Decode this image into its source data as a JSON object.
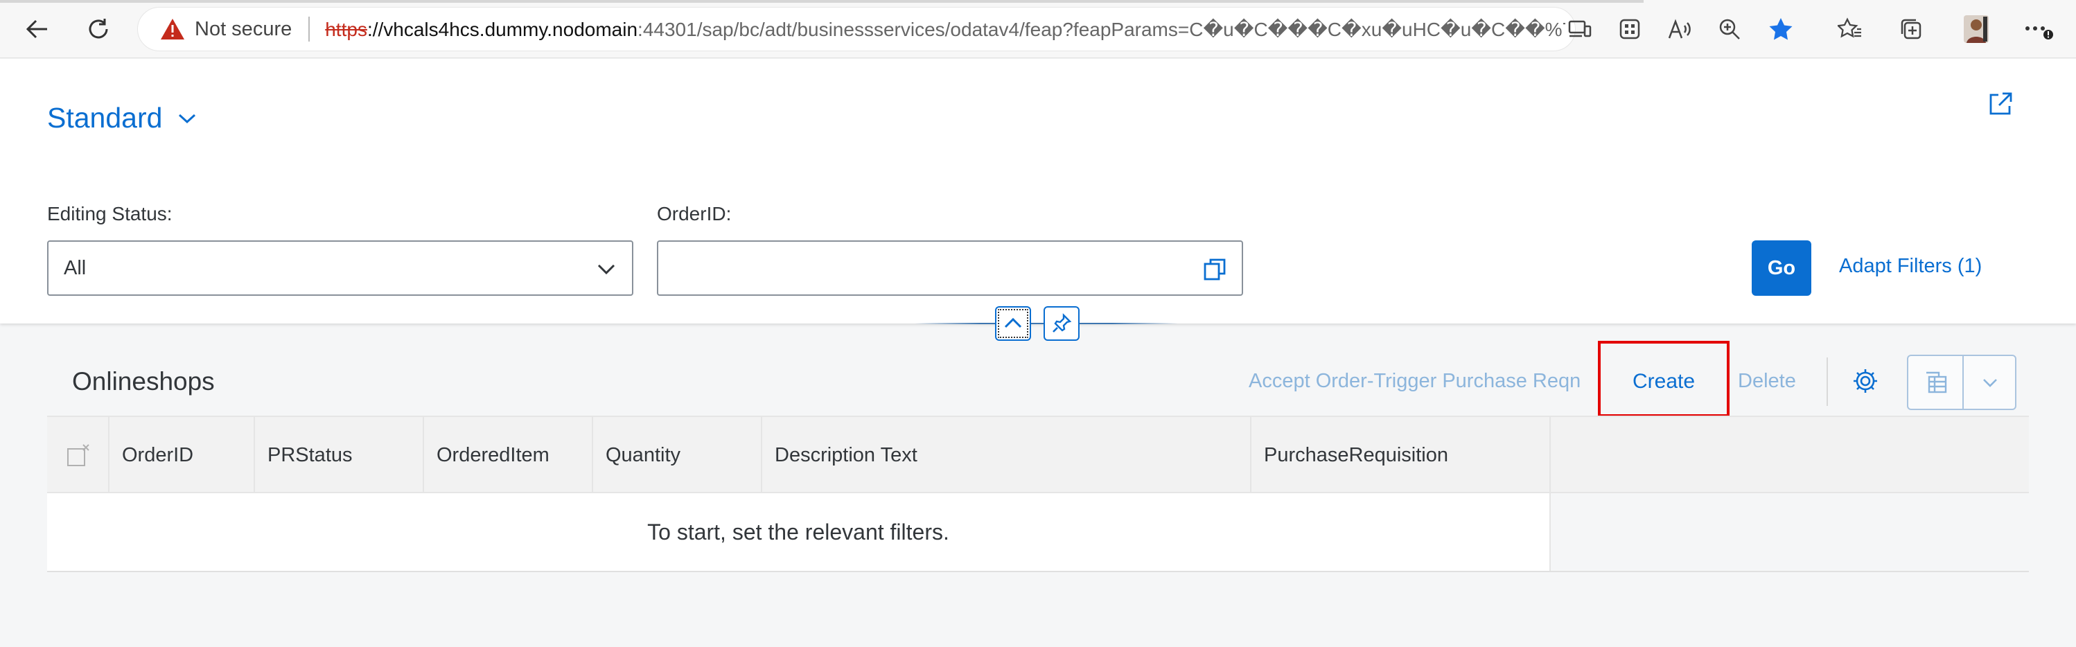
{
  "browser": {
    "security_text": "Not secure",
    "url_scheme": "https",
    "url_host": "://vhcals4hcs.dummy.nodomain",
    "url_path": ":44301/sap/bc/adt/businessservices/odatav4/feap?feapParams=C�u�C���C�xu�uHC�u�C��%7..."
  },
  "page": {
    "variant_name": "Standard",
    "filters": {
      "editing_status_label": "Editing Status:",
      "editing_status_value": "All",
      "order_id_label": "OrderID:",
      "order_id_value": ""
    },
    "go_label": "Go",
    "adapt_filters_label": "Adapt Filters (1)"
  },
  "table": {
    "title": "Onlineshops",
    "actions": {
      "accept_label": "Accept Order-Trigger Purchase Reqn",
      "create_label": "Create",
      "delete_label": "Delete"
    },
    "columns": [
      "OrderID",
      "PRStatus",
      "OrderedItem",
      "Quantity",
      "Description Text",
      "PurchaseRequisition"
    ],
    "empty_text": "To start, set the relevant filters."
  },
  "colors": {
    "accent": "#0a6ed1",
    "highlight": "#e30000"
  }
}
